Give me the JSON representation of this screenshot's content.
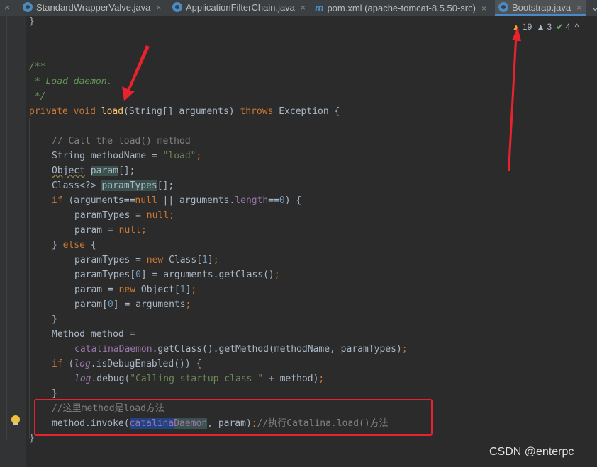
{
  "tabs": [
    {
      "label": "StandardWrapperValve.java",
      "icon": "java-class-icon",
      "active": false
    },
    {
      "label": "ApplicationFilterChain.java",
      "icon": "java-class-icon",
      "active": false
    },
    {
      "label": "pom.xml (apache-tomcat-8.5.50-src)",
      "icon": "maven-icon",
      "active": false
    },
    {
      "label": "Bootstrap.java",
      "icon": "java-class-icon",
      "active": true
    }
  ],
  "tab_close_glyph": "×",
  "tab_overflow_glyph": "⌄",
  "tab_icon_m": "m",
  "inspections": {
    "warnings": "19",
    "weak_warnings": "3",
    "typos": "4",
    "toggle_glyph": "^"
  },
  "code": {
    "l1_brace": "}",
    "l2_doc_open": "/**",
    "l3_doc_text": " * Load daemon.",
    "l4_doc_close": " */",
    "l5_private": "private",
    "l5_void": "void",
    "l5_name": "load",
    "l5_params": "(String[] arguments) ",
    "l5_throws": "throws",
    "l5_tail": " Exception {",
    "l6_comment": "// Call the load() method",
    "l7_a": "String methodName = ",
    "l7_str": "\"load\"",
    "l7_semi": ";",
    "l8_type": "Object",
    "l8_var": "param",
    "l8_tail": "[];",
    "l9_type": "Class<?> ",
    "l9_var": "paramTypes",
    "l9_tail": "[];",
    "l10_if": "if",
    "l10_a": " (arguments==",
    "l10_null": "null",
    "l10_b": " || arguments.",
    "l10_len": "length",
    "l10_c": "==",
    "l10_zero": "0",
    "l10_d": ") {",
    "l11_a": "paramTypes = ",
    "l11_null": "null",
    "l11_semi": ";",
    "l12_a": "param = ",
    "l12_null": "null",
    "l12_semi": ";",
    "l13_a": "} ",
    "l13_else": "else",
    "l13_b": " {",
    "l14_a": "paramTypes = ",
    "l14_new": "new",
    "l14_b": " Class[",
    "l14_one": "1",
    "l14_c": "]",
    "l14_semi": ";",
    "l15_a": "paramTypes[",
    "l15_zero": "0",
    "l15_b": "] = arguments.getClass()",
    "l15_semi": ";",
    "l16_a": "param = ",
    "l16_new": "new",
    "l16_b": " Object[",
    "l16_one": "1",
    "l16_c": "]",
    "l16_semi": ";",
    "l17_a": "param[",
    "l17_zero": "0",
    "l17_b": "] = arguments",
    "l17_semi": ";",
    "l18_brace": "}",
    "l19_text": "Method method =",
    "l20_field": "catalinaDaemon",
    "l20_b": ".getClass().getMethod(methodName, paramTypes)",
    "l20_semi": ";",
    "l21_if": "if",
    "l21_a": " (",
    "l21_log": "log",
    "l21_b": ".isDebugEnabled()) {",
    "l22_log": "log",
    "l22_a": ".debug(",
    "l22_str": "\"Calling startup class \"",
    "l22_b": " + method)",
    "l22_semi": ";",
    "l23_brace": "}",
    "l24_comment": "//这里method是load方法",
    "l25_a": "method.invoke(",
    "l25_hl": "catalina",
    "l25_field": "Daemon",
    "l25_b": ", param)",
    "l25_semi": ";",
    "l25_comment": "//执行Catalina.load()方法",
    "l26_brace": "}"
  },
  "watermark": "CSDN @enterpc",
  "colors": {
    "annotation_red": "#e8232d",
    "editor_bg": "#2b2b2b",
    "keyword": "#cc7832",
    "string": "#6a8759",
    "field": "#9876aa",
    "method_decl": "#ffc66d"
  }
}
